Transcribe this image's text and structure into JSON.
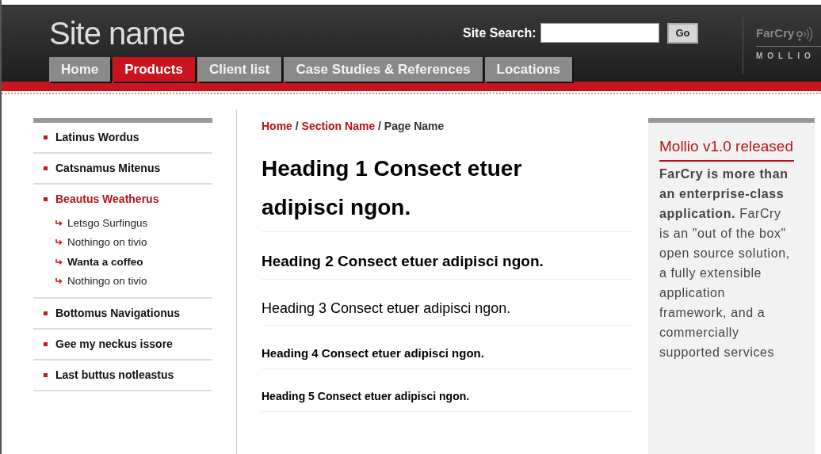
{
  "header": {
    "site_name": "Site name",
    "search": {
      "label": "Site Search:",
      "button": "Go"
    },
    "logo": {
      "brand": "FarCry",
      "sub": "MOLLIO"
    }
  },
  "tabs": [
    {
      "label": "Home",
      "selected": false
    },
    {
      "label": "Products",
      "selected": true
    },
    {
      "label": "Client list",
      "selected": false
    },
    {
      "label": "Case Studies & References",
      "selected": false
    },
    {
      "label": "Locations",
      "selected": false
    }
  ],
  "sidebar": {
    "items": [
      {
        "label": "Latinus Wordus",
        "selected": false
      },
      {
        "label": "Catsnamus Mitenus",
        "selected": false
      },
      {
        "label": "Beautus Weatherus",
        "selected": true,
        "children": [
          {
            "label": "Letsgo Surfingus",
            "selected": false
          },
          {
            "label": "Nothingo on tivio",
            "selected": false
          },
          {
            "label": "Wanta a coffeo",
            "selected": true
          },
          {
            "label": "Nothingo on tivio",
            "selected": false
          }
        ]
      },
      {
        "label": "Bottomus Navigationus",
        "selected": false
      },
      {
        "label": "Gee my neckus issore",
        "selected": false
      },
      {
        "label": "Last buttus notleastus",
        "selected": false
      }
    ]
  },
  "breadcrumb": {
    "separator": "/",
    "items": [
      {
        "label": "Home",
        "kind": "link"
      },
      {
        "label": "Section Name",
        "kind": "link"
      },
      {
        "label": "Page Name",
        "kind": "current"
      }
    ]
  },
  "headings": [
    {
      "kind": "h1",
      "text": "Heading 1 Consect etuer adipisci ngon."
    },
    {
      "kind": "h2",
      "text": "Heading 2 Consect etuer adipisci ngon."
    },
    {
      "kind": "h3",
      "text": "Heading 3 Consect etuer adipisci ngon."
    },
    {
      "kind": "h4",
      "text": "Heading 4 Consect etuer adipisci ngon."
    },
    {
      "kind": "h5",
      "text": "Heading 5 Consect etuer adipisci ngon."
    }
  ],
  "news": {
    "title": "Mollio v1.0 released",
    "body": "**FarCry is more than an enterprise-class application.** FarCry is an \"out of the box\" open source solution, a fully extensible application framework, and a commercially supported services"
  }
}
